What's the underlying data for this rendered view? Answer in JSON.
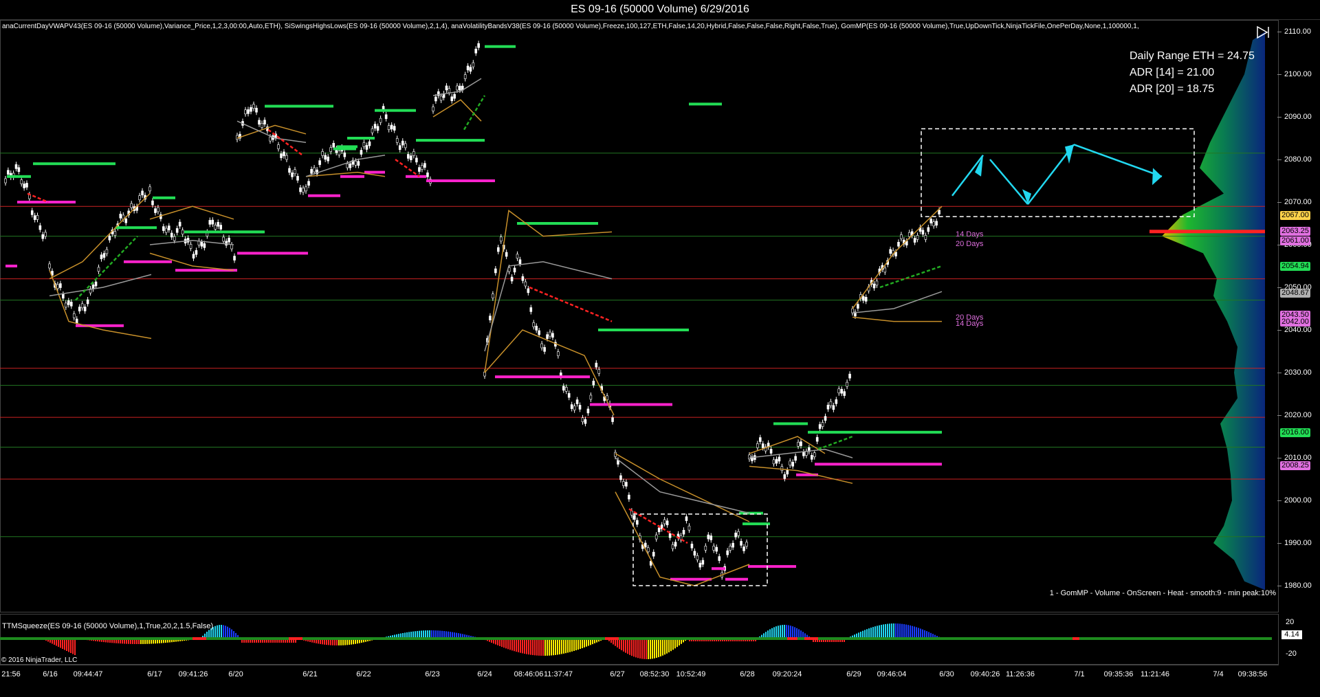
{
  "window": {
    "title": "ES 09-16 (50000 Volume)  6/29/2016"
  },
  "indicator_caption": "anaCurrentDayVWAPV43(ES 09-16 (50000 Volume),Variance_Price,1,2,3,00:00,Auto,ETH), SiSwingsHighsLows(ES 09-16 (50000 Volume),2,1,4), anaVolatilityBandsV38(ES 09-16 (50000 Volume),Freeze,100,127,ETH,False,14,20,Hybrid,False,False,False,Right,False,True), GomMP(ES 09-16 (50000 Volume),True,UpDownTick,NinjaTickFile,OnePerDay,None,1,100000,1,",
  "info": {
    "daily_range": "Daily Range ETH = 24.75",
    "adr14": "ADR [14] = 21.00",
    "adr20": "ADR [20] = 18.75"
  },
  "gom_caption": "1 - GomMP - Volume - OnScreen - Heat - smooth:9 - min peak:10%",
  "ttm_caption": "TTMSqueeze(ES 09-16 (50000 Volume),1,True,20,2,1.5,False)",
  "copyright": "© 2016 NinjaTrader, LLC",
  "annotations": {
    "top14": "14 Days",
    "top20": "20 Days",
    "bot20": "20 Days",
    "bot14": "14 Days"
  },
  "price_axis": {
    "ticks": [
      "2110.00",
      "2100.00",
      "2090.00",
      "2080.00",
      "2070.00",
      "2060.00",
      "2050.00",
      "2040.00",
      "2030.00",
      "2020.00",
      "2010.00",
      "2000.00",
      "1990.00",
      "1980.00"
    ],
    "badges": [
      {
        "label": "2067.00",
        "bg": "#ffd24a",
        "fg": "#000"
      },
      {
        "label": "2063.25",
        "bg": "#e070e0",
        "fg": "#000"
      },
      {
        "label": "2061.00",
        "bg": "#e070e0",
        "fg": "#000"
      },
      {
        "label": "2054.94",
        "bg": "#22dd55",
        "fg": "#000"
      },
      {
        "label": "2048.67",
        "bg": "#b0b0b0",
        "fg": "#000"
      },
      {
        "label": "2043.50",
        "bg": "#e070e0",
        "fg": "#000"
      },
      {
        "label": "2042.00",
        "bg": "#e070e0",
        "fg": "#000"
      },
      {
        "label": "2016.00",
        "bg": "#22dd55",
        "fg": "#000"
      },
      {
        "label": "2008.25",
        "bg": "#e070e0",
        "fg": "#000"
      }
    ]
  },
  "indicator_axis": {
    "ticks": [
      "20",
      "0",
      "-20"
    ],
    "badge": "4.14"
  },
  "time_axis": {
    "labels": [
      "21:56",
      "6/16",
      "09:44:47",
      "6/17",
      "09:41:26",
      "6/20",
      "6/21",
      "6/22",
      "6/23",
      "6/24",
      "08:46:06",
      "11:37:47",
      "6/27",
      "08:52:30",
      "10:52:49",
      "6/28",
      "09:20:24",
      "6/29",
      "09:46:04",
      "6/30",
      "09:40:26",
      "11:26:36",
      "7/1",
      "09:35:36",
      "11:21:46",
      "7/4",
      "09:38:56"
    ]
  },
  "colors": {
    "background": "#000000",
    "up_bar": "#ffffff",
    "swing_high": "#22dd55",
    "swing_low": "#ff22cc",
    "band": "#c8902a",
    "vwap": "#9a9a9a",
    "trend_up": "#22aa22",
    "trend_down": "#ff2222",
    "resistance": "#cc2222",
    "support": "#227722",
    "arrow": "#22d8f0"
  }
}
